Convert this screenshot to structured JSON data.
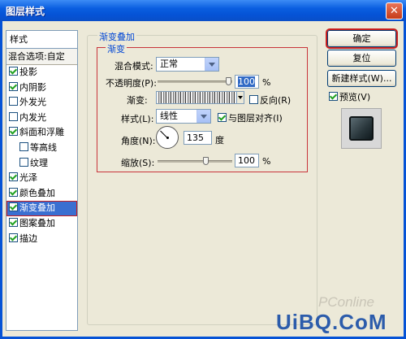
{
  "window": {
    "title": "图层样式"
  },
  "sidebar": {
    "header": "样式",
    "blend_options": "混合选项:自定",
    "items": [
      {
        "label": "投影",
        "checked": true
      },
      {
        "label": "内阴影",
        "checked": true
      },
      {
        "label": "外发光",
        "checked": false
      },
      {
        "label": "内发光",
        "checked": false
      },
      {
        "label": "斜面和浮雕",
        "checked": true
      },
      {
        "label": "等高线",
        "checked": false
      },
      {
        "label": "纹理",
        "checked": false
      },
      {
        "label": "光泽",
        "checked": true
      },
      {
        "label": "颜色叠加",
        "checked": true
      },
      {
        "label": "渐变叠加",
        "checked": true
      },
      {
        "label": "图案叠加",
        "checked": true
      },
      {
        "label": "描边",
        "checked": true
      }
    ]
  },
  "panel": {
    "outer_title": "渐变叠加",
    "inner_title": "渐变",
    "blend_mode_label": "混合模式:",
    "blend_mode_value": "正常",
    "opacity_label": "不透明度(P):",
    "opacity_value": "100",
    "opacity_unit": "%",
    "gradient_label": "渐变:",
    "reverse_label": "反向(R)",
    "reverse_checked": false,
    "style_label": "样式(L):",
    "style_value": "线性",
    "align_label": "与图层对齐(I)",
    "align_checked": true,
    "angle_label": "角度(N):",
    "angle_value": "135",
    "angle_unit": "度",
    "scale_label": "缩放(S):",
    "scale_value": "100",
    "scale_unit": "%"
  },
  "buttons": {
    "ok": "确定",
    "reset": "复位",
    "new_style": "新建样式(W)...",
    "preview_label": "预览(V)",
    "preview_checked": true
  },
  "watermark": {
    "text": "UiBQ.CoM",
    "faint": "PConline"
  },
  "colors": {
    "titlebar": "#0553d6",
    "selection": "#3a6fd1",
    "highlight_border": "#c81e1e"
  }
}
